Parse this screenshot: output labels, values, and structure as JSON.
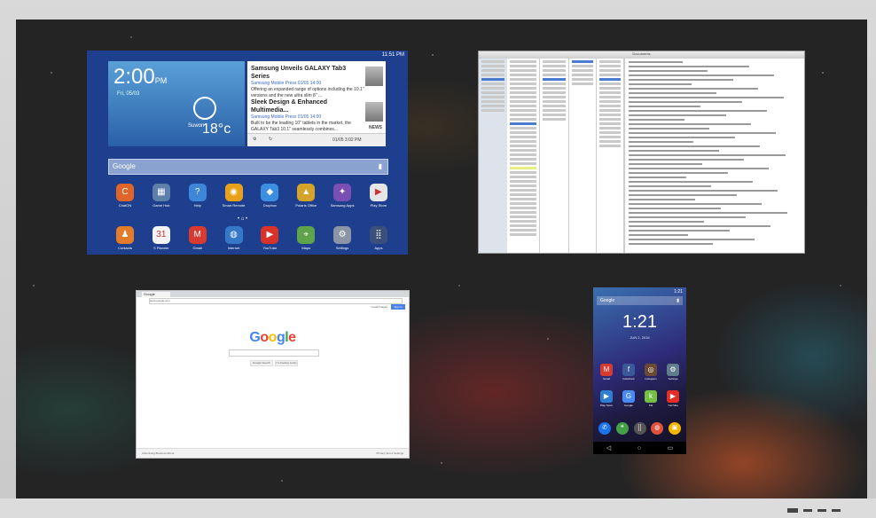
{
  "tablet": {
    "status": "11:51 PM",
    "clock": "2:00",
    "clock_suffix": "PM",
    "date": "Fri, 05/03",
    "temperature": "18°c",
    "city": "Suwon",
    "news": [
      {
        "title": "Samsung Unveils GALAXY Tab3 Series",
        "source": "Samsung Mobile Press 01/05 14:00",
        "body": "Offering an expanded range of options including the 10.1\" versions and the new ultra slim 8\" ..."
      },
      {
        "title": "Sleek Design & Enhanced Multimedia...",
        "source": "Samsung Mobile Press 01/05 14:00",
        "body": "Built to be the leading 10\" tablets in the market, the GALAXY Tab3 10.1\" seamlessly combines..."
      }
    ],
    "news_footer_time": "01/05 3:02 PM",
    "news_brand": "NEWS",
    "search_placeholder": "Google",
    "apps_row1": [
      {
        "label": "ChatON",
        "icon": "C",
        "color": "#e0652a"
      },
      {
        "label": "Game Hub",
        "icon": "▦",
        "color": "#5d7fa8"
      },
      {
        "label": "Help",
        "icon": "?",
        "color": "#3d86d9"
      },
      {
        "label": "Smart Remote",
        "icon": "◉",
        "color": "#e8a21a"
      },
      {
        "label": "Dropbox",
        "icon": "◆",
        "color": "#3b8ee0"
      },
      {
        "label": "Polaris Office",
        "icon": "▲",
        "color": "#d5a32a"
      },
      {
        "label": "Samsung Apps",
        "icon": "✦",
        "color": "#7a4fb3"
      },
      {
        "label": "Play Store",
        "icon": "▶",
        "color": "#e6e6e6"
      }
    ],
    "apps_row2": [
      {
        "label": "Contacts",
        "icon": "♟",
        "color": "#e27b2a"
      },
      {
        "label": "S Planner",
        "icon": "31",
        "color": "#f4f4f4"
      },
      {
        "label": "Gmail",
        "icon": "M",
        "color": "#d93a30"
      },
      {
        "label": "Internet",
        "icon": "◍",
        "color": "#3578c8"
      },
      {
        "label": "YouTube",
        "icon": "▶",
        "color": "#d8332b"
      },
      {
        "label": "Maps",
        "icon": "⌖",
        "color": "#5fa34a"
      },
      {
        "label": "Settings",
        "icon": "⚙",
        "color": "#8a96a6"
      },
      {
        "label": "Apps",
        "icon": "⣿",
        "color": "#3a4f7a"
      }
    ]
  },
  "desktop": {
    "window_title": "Documents"
  },
  "browser": {
    "tab": "Google",
    "url": "www.google.com",
    "logo_letters": [
      {
        "ch": "G",
        "color": "#4285f4"
      },
      {
        "ch": "o",
        "color": "#ea4335"
      },
      {
        "ch": "o",
        "color": "#fbbc05"
      },
      {
        "ch": "g",
        "color": "#4285f4"
      },
      {
        "ch": "l",
        "color": "#34a853"
      },
      {
        "ch": "e",
        "color": "#ea4335"
      }
    ],
    "top_links": "Gmail  Images",
    "sign_in": "Sign in",
    "search_button": "Google Search",
    "lucky_button": "I'm Feeling Lucky",
    "footer_left": "Advertising   Business   About",
    "footer_right": "Privacy   Terms   Settings"
  },
  "phone": {
    "status": "1:21",
    "search_placeholder": "Google",
    "clock": "1:21",
    "date": "JUN 2, 2016",
    "apps_row1": [
      {
        "label": "Gmail",
        "icon": "M",
        "color": "#d93a30"
      },
      {
        "label": "Facebook",
        "icon": "f",
        "color": "#3b5998"
      },
      {
        "label": "Instagram",
        "icon": "◎",
        "color": "#6b4a33"
      },
      {
        "label": "Settings",
        "icon": "⚙",
        "color": "#607d8b"
      }
    ],
    "apps_row2": [
      {
        "label": "Play Store",
        "icon": "▶",
        "color": "#2f7fd0"
      },
      {
        "label": "Google",
        "icon": "G",
        "color": "#4a8af4"
      },
      {
        "label": "Kik",
        "icon": "k",
        "color": "#74c043"
      },
      {
        "label": "YouTube",
        "icon": "▶",
        "color": "#e52d27"
      }
    ],
    "dock": [
      {
        "icon": "✆",
        "color": "#1a73e8"
      },
      {
        "icon": "❝",
        "color": "#43a047"
      },
      {
        "icon": "⣿",
        "color": "#555555"
      },
      {
        "icon": "◍",
        "color": "#e0513a"
      },
      {
        "icon": "▣",
        "color": "#f4b400"
      }
    ],
    "nav": [
      "◁",
      "○",
      "▭"
    ]
  }
}
